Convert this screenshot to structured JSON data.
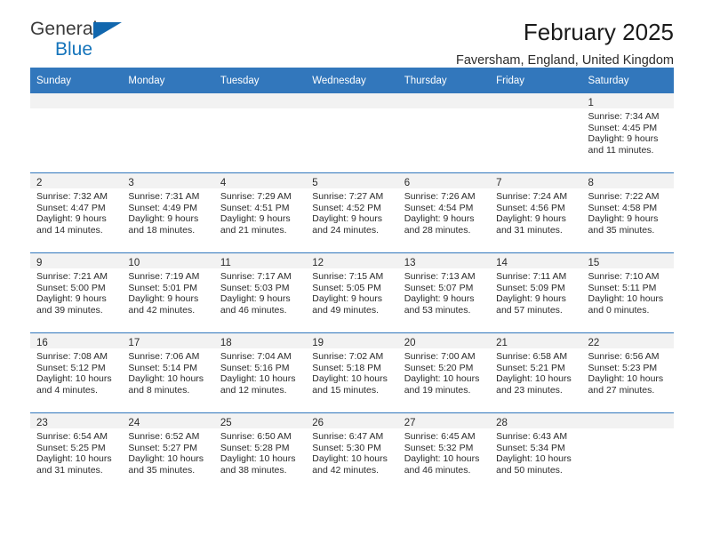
{
  "logo": {
    "primary_text": "General",
    "secondary_text": "Blue",
    "triangle_icon": "triangle-icon",
    "primary_color": "#3b3b3b",
    "secondary_color": "#1574bb",
    "triangle_color": "#1167ae"
  },
  "header": {
    "title": "February 2025",
    "subtitle": "Faversham, England, United Kingdom"
  },
  "theme": {
    "header_blue": "#3277bc",
    "band_gray": "#f2f2f2",
    "text_dark": "#2b2b2b"
  },
  "calendar": {
    "weekday_headers": [
      "Sunday",
      "Monday",
      "Tuesday",
      "Wednesday",
      "Thursday",
      "Friday",
      "Saturday"
    ],
    "weeks": [
      [
        {
          "blank": true
        },
        {
          "blank": true
        },
        {
          "blank": true
        },
        {
          "blank": true
        },
        {
          "blank": true
        },
        {
          "blank": true
        },
        {
          "day": "1",
          "sunrise": "Sunrise: 7:34 AM",
          "sunset": "Sunset: 4:45 PM",
          "daylight_line1": "Daylight: 9 hours",
          "daylight_line2": "and 11 minutes."
        }
      ],
      [
        {
          "day": "2",
          "sunrise": "Sunrise: 7:32 AM",
          "sunset": "Sunset: 4:47 PM",
          "daylight_line1": "Daylight: 9 hours",
          "daylight_line2": "and 14 minutes."
        },
        {
          "day": "3",
          "sunrise": "Sunrise: 7:31 AM",
          "sunset": "Sunset: 4:49 PM",
          "daylight_line1": "Daylight: 9 hours",
          "daylight_line2": "and 18 minutes."
        },
        {
          "day": "4",
          "sunrise": "Sunrise: 7:29 AM",
          "sunset": "Sunset: 4:51 PM",
          "daylight_line1": "Daylight: 9 hours",
          "daylight_line2": "and 21 minutes."
        },
        {
          "day": "5",
          "sunrise": "Sunrise: 7:27 AM",
          "sunset": "Sunset: 4:52 PM",
          "daylight_line1": "Daylight: 9 hours",
          "daylight_line2": "and 24 minutes."
        },
        {
          "day": "6",
          "sunrise": "Sunrise: 7:26 AM",
          "sunset": "Sunset: 4:54 PM",
          "daylight_line1": "Daylight: 9 hours",
          "daylight_line2": "and 28 minutes."
        },
        {
          "day": "7",
          "sunrise": "Sunrise: 7:24 AM",
          "sunset": "Sunset: 4:56 PM",
          "daylight_line1": "Daylight: 9 hours",
          "daylight_line2": "and 31 minutes."
        },
        {
          "day": "8",
          "sunrise": "Sunrise: 7:22 AM",
          "sunset": "Sunset: 4:58 PM",
          "daylight_line1": "Daylight: 9 hours",
          "daylight_line2": "and 35 minutes."
        }
      ],
      [
        {
          "day": "9",
          "sunrise": "Sunrise: 7:21 AM",
          "sunset": "Sunset: 5:00 PM",
          "daylight_line1": "Daylight: 9 hours",
          "daylight_line2": "and 39 minutes."
        },
        {
          "day": "10",
          "sunrise": "Sunrise: 7:19 AM",
          "sunset": "Sunset: 5:01 PM",
          "daylight_line1": "Daylight: 9 hours",
          "daylight_line2": "and 42 minutes."
        },
        {
          "day": "11",
          "sunrise": "Sunrise: 7:17 AM",
          "sunset": "Sunset: 5:03 PM",
          "daylight_line1": "Daylight: 9 hours",
          "daylight_line2": "and 46 minutes."
        },
        {
          "day": "12",
          "sunrise": "Sunrise: 7:15 AM",
          "sunset": "Sunset: 5:05 PM",
          "daylight_line1": "Daylight: 9 hours",
          "daylight_line2": "and 49 minutes."
        },
        {
          "day": "13",
          "sunrise": "Sunrise: 7:13 AM",
          "sunset": "Sunset: 5:07 PM",
          "daylight_line1": "Daylight: 9 hours",
          "daylight_line2": "and 53 minutes."
        },
        {
          "day": "14",
          "sunrise": "Sunrise: 7:11 AM",
          "sunset": "Sunset: 5:09 PM",
          "daylight_line1": "Daylight: 9 hours",
          "daylight_line2": "and 57 minutes."
        },
        {
          "day": "15",
          "sunrise": "Sunrise: 7:10 AM",
          "sunset": "Sunset: 5:11 PM",
          "daylight_line1": "Daylight: 10 hours",
          "daylight_line2": "and 0 minutes."
        }
      ],
      [
        {
          "day": "16",
          "sunrise": "Sunrise: 7:08 AM",
          "sunset": "Sunset: 5:12 PM",
          "daylight_line1": "Daylight: 10 hours",
          "daylight_line2": "and 4 minutes."
        },
        {
          "day": "17",
          "sunrise": "Sunrise: 7:06 AM",
          "sunset": "Sunset: 5:14 PM",
          "daylight_line1": "Daylight: 10 hours",
          "daylight_line2": "and 8 minutes."
        },
        {
          "day": "18",
          "sunrise": "Sunrise: 7:04 AM",
          "sunset": "Sunset: 5:16 PM",
          "daylight_line1": "Daylight: 10 hours",
          "daylight_line2": "and 12 minutes."
        },
        {
          "day": "19",
          "sunrise": "Sunrise: 7:02 AM",
          "sunset": "Sunset: 5:18 PM",
          "daylight_line1": "Daylight: 10 hours",
          "daylight_line2": "and 15 minutes."
        },
        {
          "day": "20",
          "sunrise": "Sunrise: 7:00 AM",
          "sunset": "Sunset: 5:20 PM",
          "daylight_line1": "Daylight: 10 hours",
          "daylight_line2": "and 19 minutes."
        },
        {
          "day": "21",
          "sunrise": "Sunrise: 6:58 AM",
          "sunset": "Sunset: 5:21 PM",
          "daylight_line1": "Daylight: 10 hours",
          "daylight_line2": "and 23 minutes."
        },
        {
          "day": "22",
          "sunrise": "Sunrise: 6:56 AM",
          "sunset": "Sunset: 5:23 PM",
          "daylight_line1": "Daylight: 10 hours",
          "daylight_line2": "and 27 minutes."
        }
      ],
      [
        {
          "day": "23",
          "sunrise": "Sunrise: 6:54 AM",
          "sunset": "Sunset: 5:25 PM",
          "daylight_line1": "Daylight: 10 hours",
          "daylight_line2": "and 31 minutes."
        },
        {
          "day": "24",
          "sunrise": "Sunrise: 6:52 AM",
          "sunset": "Sunset: 5:27 PM",
          "daylight_line1": "Daylight: 10 hours",
          "daylight_line2": "and 35 minutes."
        },
        {
          "day": "25",
          "sunrise": "Sunrise: 6:50 AM",
          "sunset": "Sunset: 5:28 PM",
          "daylight_line1": "Daylight: 10 hours",
          "daylight_line2": "and 38 minutes."
        },
        {
          "day": "26",
          "sunrise": "Sunrise: 6:47 AM",
          "sunset": "Sunset: 5:30 PM",
          "daylight_line1": "Daylight: 10 hours",
          "daylight_line2": "and 42 minutes."
        },
        {
          "day": "27",
          "sunrise": "Sunrise: 6:45 AM",
          "sunset": "Sunset: 5:32 PM",
          "daylight_line1": "Daylight: 10 hours",
          "daylight_line2": "and 46 minutes."
        },
        {
          "day": "28",
          "sunrise": "Sunrise: 6:43 AM",
          "sunset": "Sunset: 5:34 PM",
          "daylight_line1": "Daylight: 10 hours",
          "daylight_line2": "and 50 minutes."
        },
        {
          "blank": true
        }
      ]
    ]
  }
}
